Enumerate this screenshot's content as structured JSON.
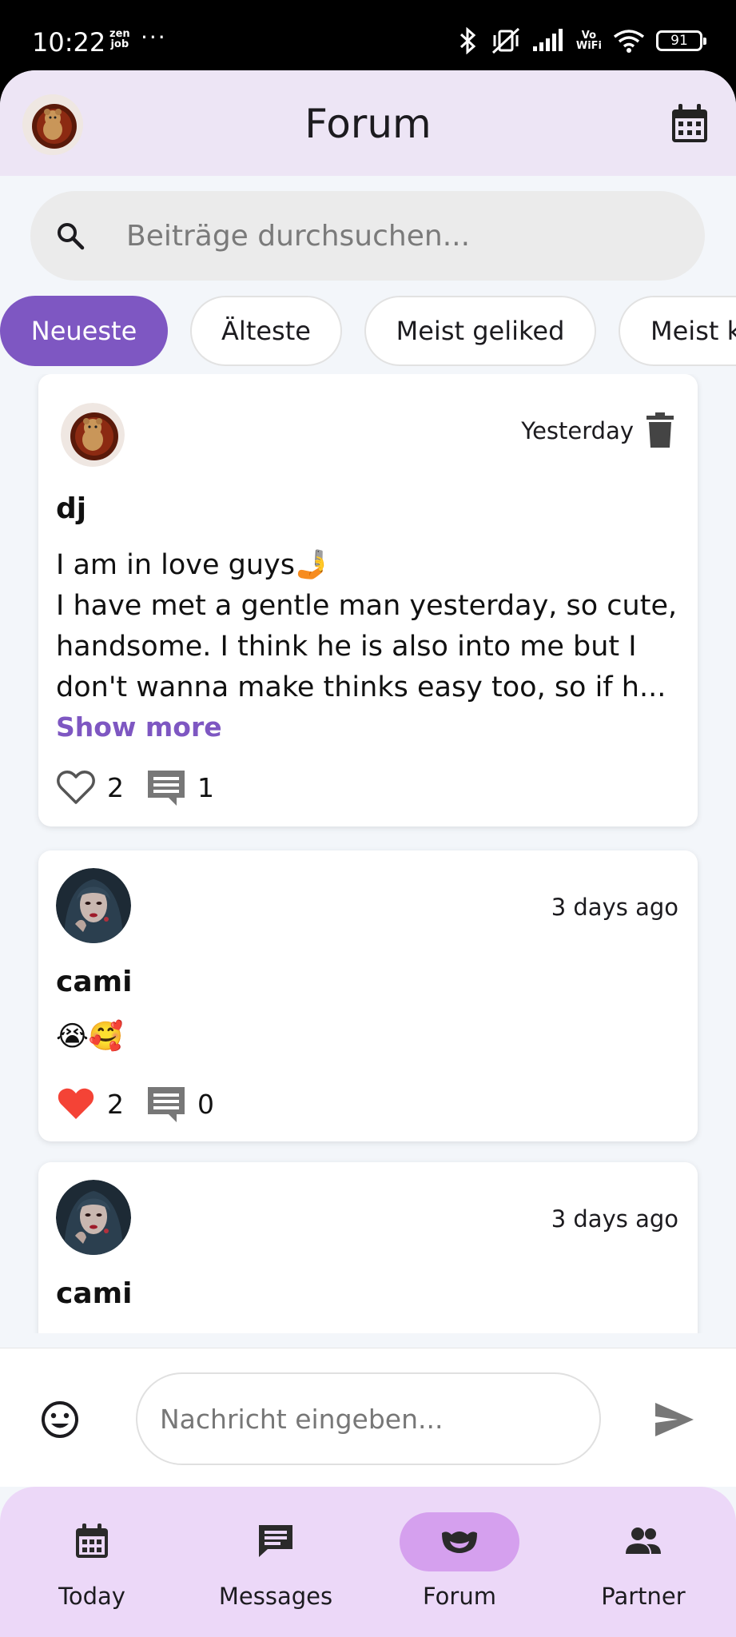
{
  "status_bar": {
    "time": "10:22",
    "notification_badge_top": "zen",
    "notification_badge_bottom": "job",
    "more": "···",
    "vowifi_top": "Vo",
    "vowifi_bottom": "WiFi",
    "battery": "91"
  },
  "app_bar": {
    "title": "Forum"
  },
  "search": {
    "placeholder": "Beiträge durchsuchen..."
  },
  "filters": [
    {
      "label": "Neueste",
      "active": true
    },
    {
      "label": "Älteste",
      "active": false
    },
    {
      "label": "Meist geliked",
      "active": false
    },
    {
      "label": "Meist k",
      "active": false
    }
  ],
  "posts": [
    {
      "author": "dj",
      "time": "Yesterday",
      "line1": "I am in love guys🤳",
      "line2": "I have met a gentle man yesterday, so cute,",
      "line3": "handsome. I think he is also into me but I",
      "line4": "don't wanna make thinks easy too, so if h...",
      "show_more": "Show more",
      "likes": "2",
      "comments": "1",
      "liked": false
    },
    {
      "author": "cami",
      "time": "3 days ago",
      "text": "😭🥰",
      "likes": "2",
      "comments": "0",
      "liked": true
    },
    {
      "author": "cami",
      "time": "3 days ago"
    }
  ],
  "composer": {
    "placeholder": "Nachricht eingeben..."
  },
  "bottom_nav": [
    {
      "label": "Today",
      "icon": "calendar-icon"
    },
    {
      "label": "Messages",
      "icon": "message-icon"
    },
    {
      "label": "Forum",
      "icon": "mask-icon",
      "active": true
    },
    {
      "label": "Partner",
      "icon": "people-icon"
    }
  ],
  "colors": {
    "accent": "#7e57c2",
    "app_bar_bg": "#ede5f5",
    "nav_bg": "#ecd8f8",
    "nav_active_pill": "#d5a0ee",
    "like_red": "#f44336"
  }
}
